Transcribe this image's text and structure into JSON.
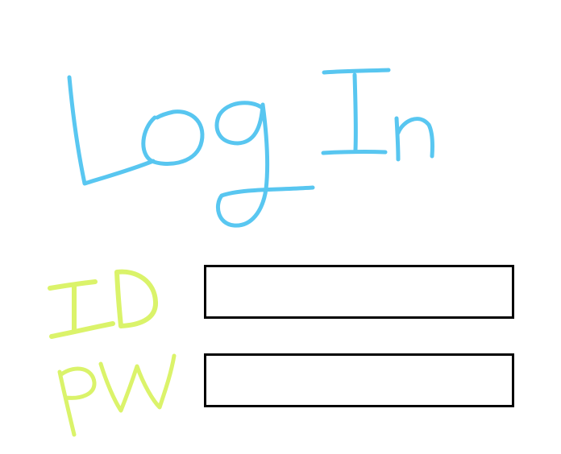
{
  "title": "Log In",
  "id_label": "ID",
  "pw_label": "PW",
  "id_field": {
    "value": "",
    "placeholder": ""
  },
  "pw_field": {
    "value": "",
    "placeholder": ""
  },
  "colors": {
    "title_ink": "#3cbdee",
    "label_ink": "#d7f25a",
    "field_border": "#000000",
    "background": "#ffffff"
  }
}
